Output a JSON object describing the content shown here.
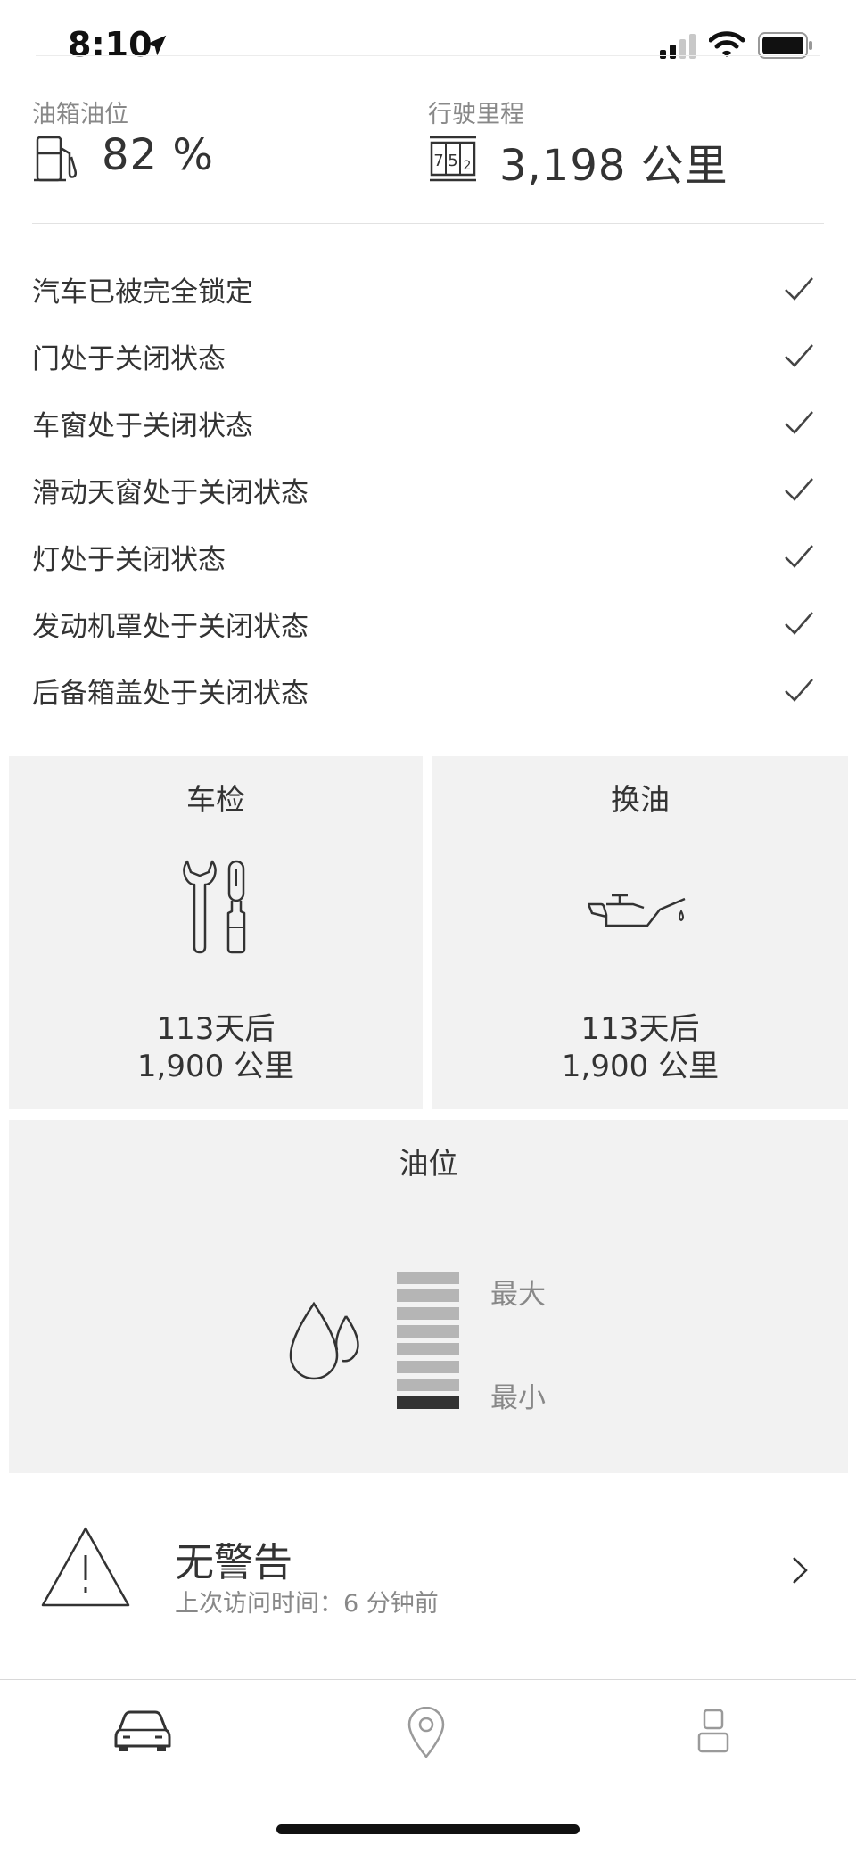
{
  "status_bar": {
    "time": "8:10"
  },
  "metrics": {
    "fuel": {
      "label": "油箱油位",
      "value": "82 %"
    },
    "odometer": {
      "label": "行驶里程",
      "value": "3,198 公里"
    }
  },
  "status_items": [
    {
      "text": "汽车已被完全锁定"
    },
    {
      "text": "门处于关闭状态"
    },
    {
      "text": "车窗处于关闭状态"
    },
    {
      "text": "滑动天窗处于关闭状态"
    },
    {
      "text": "灯处于关闭状态"
    },
    {
      "text": "发动机罩处于关闭状态"
    },
    {
      "text": "后备箱盖处于关闭状态"
    }
  ],
  "cards": {
    "inspection": {
      "title": "车检",
      "line1": "113天后",
      "line2": "1,900 公里"
    },
    "oil_change": {
      "title": "换油",
      "line1": "113天后",
      "line2": "1,900 公里"
    },
    "oil_level": {
      "title": "油位",
      "max_label": "最大",
      "min_label": "最小",
      "level_segments": 1,
      "total_segments": 8
    }
  },
  "warnings": {
    "title": "无警告",
    "subtitle": "上次访问时间：6 分钟前"
  },
  "tab_bar": {
    "items": [
      "car-icon",
      "location-pin-icon",
      "profile-icon"
    ],
    "active": 0
  },
  "colors": {
    "card_bg": "#f2f2f2",
    "text": "#333333",
    "muted": "#888888",
    "gauge_fill": "#333333",
    "gauge_empty": "#b5b5b5"
  }
}
